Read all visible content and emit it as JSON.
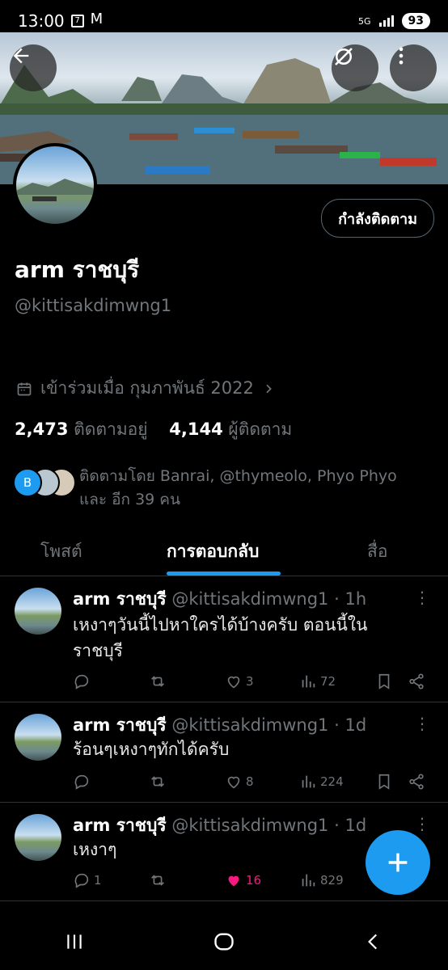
{
  "status_bar": {
    "time": "13:00",
    "network": "5G",
    "battery": "93"
  },
  "profile": {
    "name": "arm ราชบุรี",
    "handle": "@kittisakdimwng1",
    "follow_button": "กำลังติดตาม",
    "joined": "เข้าร่วมเมื่อ กุมภาพันธ์ 2022",
    "following_count": "2,473",
    "following_label": "ติดตามอยู่",
    "followers_count": "4,144",
    "followers_label": "ผู้ติดตาม",
    "followed_by_line1": "ติดตามโดย Banrai, @thymeolo, Phyo Phyo",
    "followed_by_line2": "และ อีก 39 คน",
    "followed_by_avatar_letter": "B"
  },
  "tabs": [
    {
      "label": "โพสต์",
      "active": false
    },
    {
      "label": "การตอบกลับ",
      "active": true
    },
    {
      "label": "สื่อ",
      "active": false
    }
  ],
  "tweets": [
    {
      "name": "arm ราชบุรี",
      "handle": "@kittisakdimwng1",
      "time": "· 1h",
      "text": "เหงาๆวันนี้ไปหาใครได้บ้างครับ ตอนนี้ใน ราชบุรี",
      "replies": "",
      "retweets": "",
      "likes": "3",
      "views": "72"
    },
    {
      "name": "arm ราชบุรี",
      "handle": "@kittisakdimwng1",
      "time": "· 1d",
      "text": "ร้อนๆเหงาๆทักได้ครับ",
      "replies": "",
      "retweets": "",
      "likes": "8",
      "views": "224"
    },
    {
      "name": "arm ราชบุรี",
      "handle": "@kittisakdimwng1",
      "time": "· 1d",
      "text": "เหงาๆ",
      "replies": "1",
      "retweets": "",
      "likes": "16",
      "views": "829"
    }
  ],
  "colors": {
    "accent": "#1d9bf0",
    "like": "#f91880",
    "muted": "#71767b"
  },
  "icons": [
    "back-arrow-icon",
    "hide-icon",
    "more-vertical-icon",
    "calendar-icon",
    "chevron-right-icon",
    "reply-icon",
    "retweet-icon",
    "heart-icon",
    "views-icon",
    "bookmark-icon",
    "share-icon",
    "plus-icon"
  ]
}
